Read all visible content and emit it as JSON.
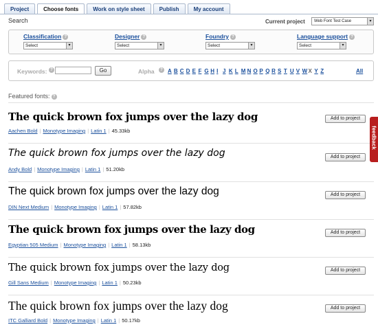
{
  "tabs": [
    {
      "label": "Project",
      "active": false
    },
    {
      "label": "Choose fonts",
      "active": true
    },
    {
      "label": "Work on style sheet",
      "active": false
    },
    {
      "label": "Publish",
      "active": false
    },
    {
      "label": "My account",
      "active": false
    }
  ],
  "search": {
    "title": "Search",
    "current_project_label": "Current project",
    "current_project_value": "Web Font Test Case"
  },
  "filters": [
    {
      "label": "Classification",
      "value": "Select"
    },
    {
      "label": "Designer",
      "value": "Select"
    },
    {
      "label": "Foundry",
      "value": "Select"
    },
    {
      "label": "Language support",
      "value": "Select"
    }
  ],
  "keywords": {
    "label": "Keywords:",
    "value": "",
    "go_label": "Go"
  },
  "alpha": {
    "label": "Alpha",
    "letters": [
      "A",
      "B",
      "C",
      "D",
      "E",
      "F",
      "G",
      "H",
      "I",
      "J",
      "K",
      "L",
      "M",
      "N",
      "O",
      "P",
      "Q",
      "R",
      "S",
      "T",
      "U",
      "V",
      "W",
      "X",
      "Y",
      "Z"
    ],
    "dim_letters": [
      "X"
    ],
    "all_label": "All"
  },
  "featured_label": "Featured fonts:",
  "sample_text": "The quick brown fox jumps over the lazy dog",
  "add_label": "Add to project",
  "fonts": [
    {
      "name": "Aachen Bold",
      "foundry": "Monotype Imaging",
      "language": "Latin 1",
      "size": "45.33kb"
    },
    {
      "name": "Andy Bold",
      "foundry": "Monotype Imaging",
      "language": "Latin 1",
      "size": "51.20kb"
    },
    {
      "name": "DIN Next Medium",
      "foundry": "Monotype Imaging",
      "language": "Latin 1",
      "size": "57.82kb"
    },
    {
      "name": "Egyptian 505 Medium",
      "foundry": "Monotype Imaging",
      "language": "Latin 1",
      "size": "58.13kb"
    },
    {
      "name": "Gill Sans Medium",
      "foundry": "Monotype Imaging",
      "language": "Latin 1",
      "size": "50.23kb"
    },
    {
      "name": "ITC Galliard Bold",
      "foundry": "Monotype Imaging",
      "language": "Latin 1",
      "size": "50.17kb"
    }
  ],
  "feedback_label": "feedback",
  "colors": {
    "link": "#1a4f9c",
    "feedback": "#b81e1e"
  }
}
